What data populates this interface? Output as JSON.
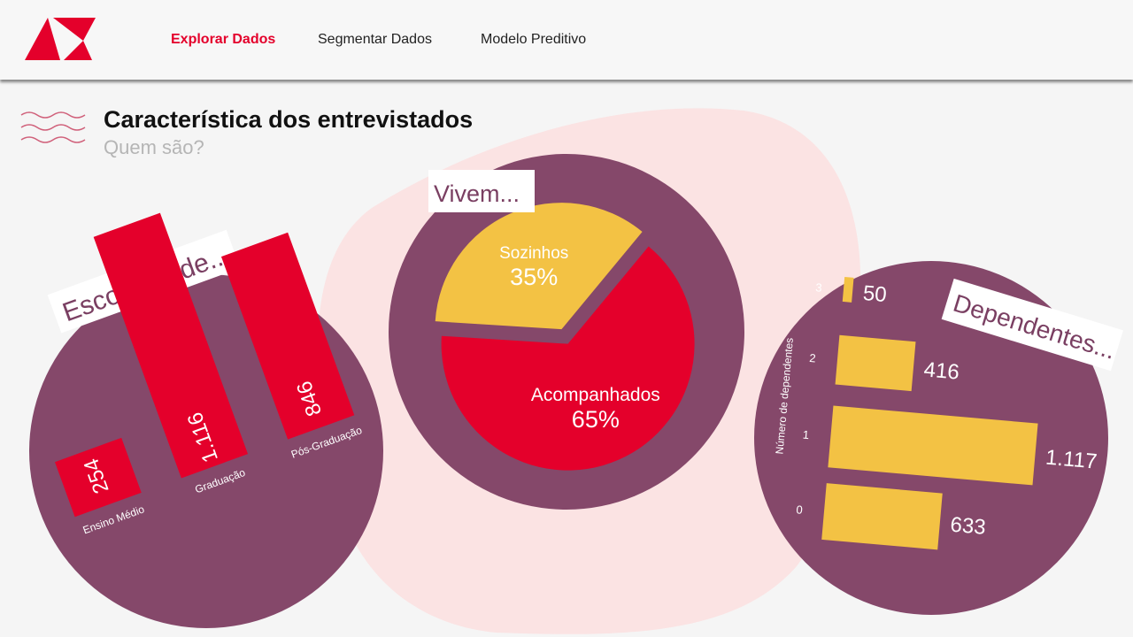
{
  "colors": {
    "accent": "#e4002b",
    "plum": "#85486a",
    "yellow": "#f3c244",
    "blob": "#fbe3e3"
  },
  "nav": {
    "items": [
      {
        "label": "Explorar Dados",
        "active": true
      },
      {
        "label": "Segmentar Dados",
        "active": false
      },
      {
        "label": "Modelo Preditivo",
        "active": false
      }
    ]
  },
  "page": {
    "title": "Característica dos entrevistados",
    "subtitle": "Quem são?"
  },
  "chart_data": [
    {
      "type": "bar",
      "title": "Escolaridade...",
      "categories": [
        "Ensino Médio",
        "Graduação",
        "Pós-Graduação"
      ],
      "values": [
        254,
        1116,
        846
      ],
      "value_labels": [
        "254",
        "1.116",
        "846"
      ]
    },
    {
      "type": "pie",
      "title": "Vivem...",
      "categories": [
        "Sozinhos",
        "Acompanhados"
      ],
      "values": [
        35,
        65
      ],
      "value_labels": [
        "35%",
        "65%"
      ]
    },
    {
      "type": "bar",
      "orientation": "horizontal",
      "title": "Dependentes...",
      "ylabel": "Número de dependentes",
      "categories": [
        "3",
        "2",
        "1",
        "0"
      ],
      "values": [
        50,
        416,
        1117,
        633
      ],
      "value_labels": [
        "50",
        "416",
        "1.117",
        "633"
      ]
    }
  ]
}
